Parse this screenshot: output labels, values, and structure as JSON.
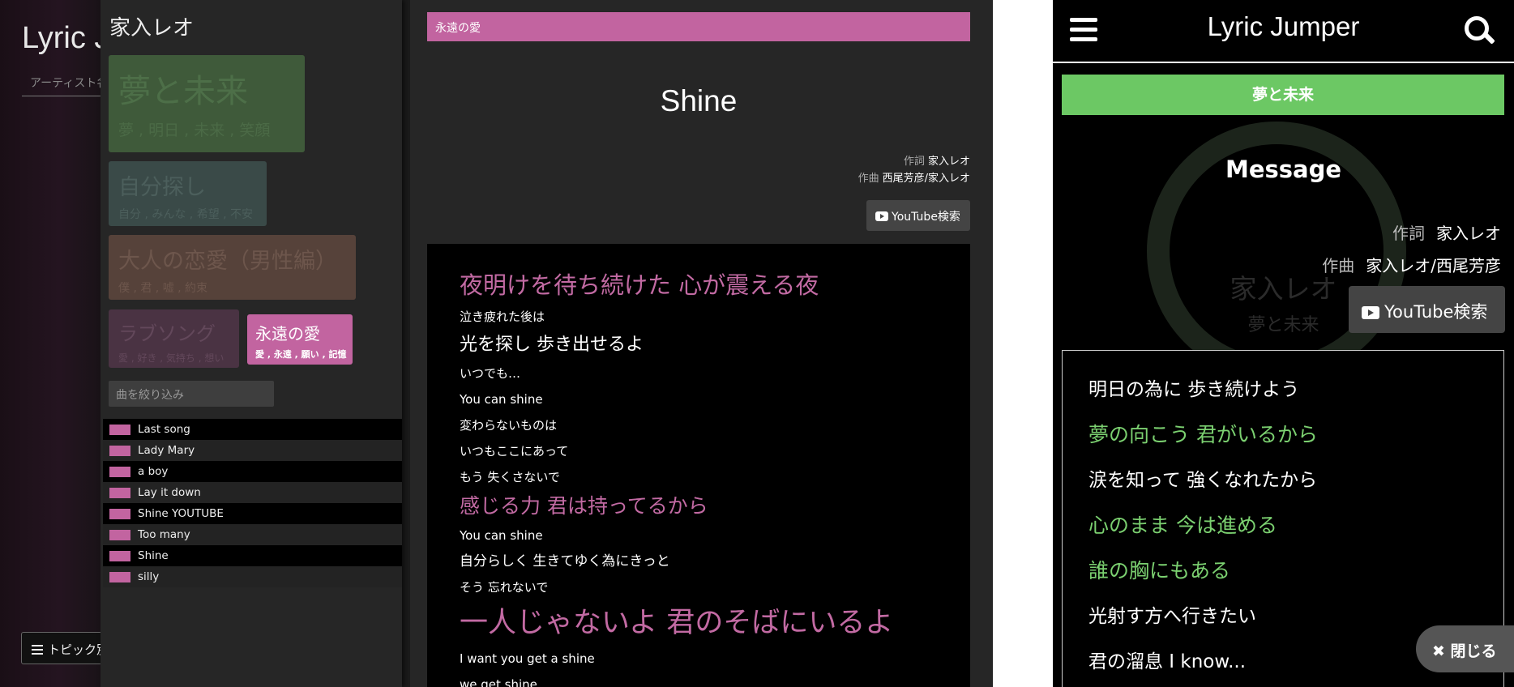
{
  "desktop": {
    "site_title": "Lyric Jumper",
    "search_placeholder": "アーティスト名を入力",
    "topic_button_label": "トピック別"
  },
  "topic_panel": {
    "artist": "家入レオ",
    "topics": [
      {
        "name": "夢と未来",
        "words": "夢 , 明日 , 未来 , 笑顔",
        "color": "#3f5a3a"
      },
      {
        "name": "自分探し",
        "words": "自分 , みんな , 希望 , 不安",
        "color": "#3a4a48"
      },
      {
        "name": "大人の恋愛（男性編）",
        "words": "僕 , 君 , 嘘 , 約束",
        "color": "#56423a"
      },
      {
        "name": "ラブソング",
        "words": "愛 , 好き , 気持ち , 想い",
        "color": "#4a3343"
      },
      {
        "name": "永遠の愛",
        "words": "愛 , 永遠 , 願い , 記憶",
        "color": "#c264a0",
        "selected": true
      }
    ],
    "filter_placeholder": "曲を絞り込み",
    "songs": [
      "Last song",
      "Lady Mary",
      "a boy",
      "Lay it down",
      "Shine YOUTUBE",
      "Too many",
      "Shine",
      "silly"
    ]
  },
  "detail": {
    "topic_label": "永遠の愛",
    "song_title": "Shine",
    "lyricist_label": "作詞",
    "lyricist": "家入レオ",
    "composer_label": "作曲",
    "composer": "西尾芳彦/家入レオ",
    "youtube_button": "YouTube検索",
    "lyrics": [
      "夜明けを待ち続けた 心が震える夜",
      "泣き疲れた後は",
      "光を探し 歩き出せるよ",
      "いつでも…",
      "You can shine",
      "変わらないものは",
      "いつもここにあって",
      "もう 失くさないで",
      "感じる力 君は持ってるから",
      "You can shine",
      "自分らしく 生きてゆく為にきっと",
      "そう 忘れないで",
      "一人じゃないよ 君のそばにいるよ",
      "I want you get a shine",
      "we get shine"
    ],
    "accent_color": "#c264a0"
  },
  "mobile": {
    "app_title": "Lyric Jumper",
    "topic_label": "夢と未来",
    "bg_artist": "家入レオ",
    "bg_topic": "夢と未来",
    "song_title": "Message",
    "lyricist_label": "作詞",
    "lyricist": "家入レオ",
    "composer_label": "作曲",
    "composer": "家入レオ/西尾芳彦",
    "youtube_button": "YouTube検索",
    "lyrics": [
      "明日の為に 歩き続けよう",
      "夢の向こう 君がいるから",
      "涙を知って 強くなれたから",
      "心のまま 今は進める",
      "誰の胸にもある",
      "光射す方へ行きたい",
      "君の溜息 I know..."
    ],
    "close_button": "閉じる",
    "accent_color": "#6cc864"
  }
}
